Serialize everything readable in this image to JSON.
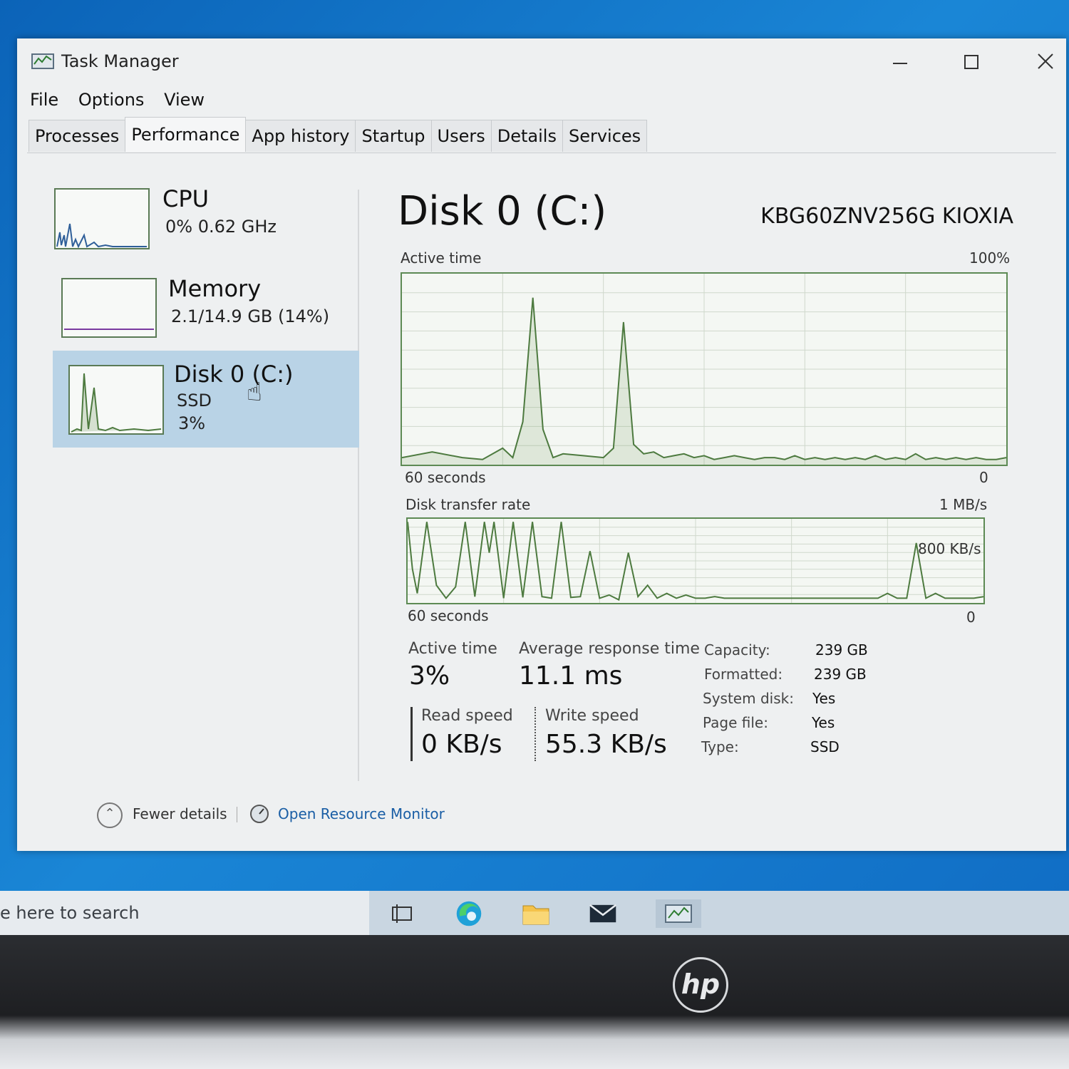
{
  "window": {
    "title": "Task Manager"
  },
  "menu": [
    "File",
    "Options",
    "View"
  ],
  "tabs": [
    "Processes",
    "Performance",
    "App history",
    "Startup",
    "Users",
    "Details",
    "Services"
  ],
  "sidebar": {
    "cpu": {
      "name": "CPU",
      "sub": "0%  0.62 GHz"
    },
    "memory": {
      "name": "Memory",
      "sub": "2.1/14.9 GB (14%)"
    },
    "disk": {
      "name": "Disk 0 (C:)",
      "type": "SSD",
      "pct": "3%"
    }
  },
  "main": {
    "title": "Disk 0 (C:)",
    "model": "KBG60ZNV256G KIOXIA",
    "active_graph": {
      "label": "Active time",
      "max": "100%",
      "xleft": "60 seconds",
      "xright": "0"
    },
    "transfer_graph": {
      "label": "Disk transfer rate",
      "max": "1 MB/s",
      "mid": "800 KB/s",
      "xleft": "60 seconds",
      "xright": "0"
    },
    "stats": {
      "active_time_label": "Active time",
      "active_time": "3%",
      "resp_label": "Average response time",
      "resp": "11.1 ms",
      "read_label": "Read speed",
      "read": "0 KB/s",
      "write_label": "Write speed",
      "write": "55.3 KB/s"
    },
    "props": [
      {
        "label": "Capacity:",
        "value": "239 GB"
      },
      {
        "label": "Formatted:",
        "value": "239 GB"
      },
      {
        "label": "System disk:",
        "value": "Yes"
      },
      {
        "label": "Page file:",
        "value": "Yes"
      },
      {
        "label": "Type:",
        "value": "SSD"
      }
    ]
  },
  "footer": {
    "fewer": "Fewer details",
    "resmon": "Open Resource Monitor"
  },
  "taskbar": {
    "search": "e here to search"
  },
  "brand": {
    "logo": "hp"
  },
  "chart_data": [
    {
      "type": "area",
      "title": "Active time",
      "ylim": [
        0,
        100
      ],
      "x": [
        60,
        57,
        54,
        52,
        50,
        49,
        48,
        47,
        46,
        45,
        44,
        42,
        40,
        39,
        38,
        37,
        36,
        35,
        34,
        33,
        32,
        31,
        30,
        29,
        28,
        27,
        26,
        25,
        24,
        23,
        22,
        21,
        20,
        19,
        18,
        17,
        16,
        15,
        14,
        13,
        12,
        11,
        10,
        9,
        8,
        7,
        6,
        5,
        4,
        3,
        2,
        1,
        0
      ],
      "values": [
        3,
        6,
        3,
        2,
        8,
        3,
        22,
        88,
        18,
        3,
        5,
        4,
        3,
        8,
        75,
        10,
        5,
        6,
        3,
        4,
        5,
        3,
        4,
        2,
        3,
        4,
        3,
        2,
        3,
        3,
        2,
        4,
        2,
        3,
        2,
        3,
        2,
        3,
        2,
        4,
        2,
        3,
        2,
        5,
        2,
        3,
        2,
        3,
        2,
        3,
        2,
        2,
        3
      ]
    },
    {
      "type": "line",
      "title": "Disk transfer rate",
      "ylim": [
        0,
        1000
      ],
      "x": [
        60,
        59.5,
        59,
        58,
        57,
        56,
        55,
        54,
        53,
        52,
        51.5,
        51,
        50,
        49,
        48,
        47,
        46,
        45,
        44,
        43,
        42,
        41,
        40,
        39,
        38,
        37,
        36,
        35,
        34,
        33,
        32,
        31,
        30,
        29,
        28,
        27,
        26,
        25,
        24,
        23,
        22,
        21,
        20,
        19,
        18,
        17,
        16,
        15,
        14,
        13,
        12,
        11,
        10,
        9,
        8,
        7,
        6,
        5,
        4,
        3,
        2,
        1,
        0
      ],
      "values": [
        980,
        400,
        100,
        980,
        200,
        40,
        180,
        980,
        60,
        980,
        600,
        980,
        40,
        980,
        50,
        980,
        60,
        40,
        980,
        50,
        60,
        620,
        40,
        80,
        20,
        600,
        60,
        200,
        40,
        100,
        40,
        80,
        40,
        40,
        60,
        40,
        40,
        40,
        40,
        40,
        40,
        40,
        40,
        40,
        40,
        40,
        40,
        40,
        40,
        40,
        40,
        40,
        100,
        40,
        40,
        720,
        40,
        100,
        40,
        40,
        40,
        40,
        60
      ]
    }
  ]
}
